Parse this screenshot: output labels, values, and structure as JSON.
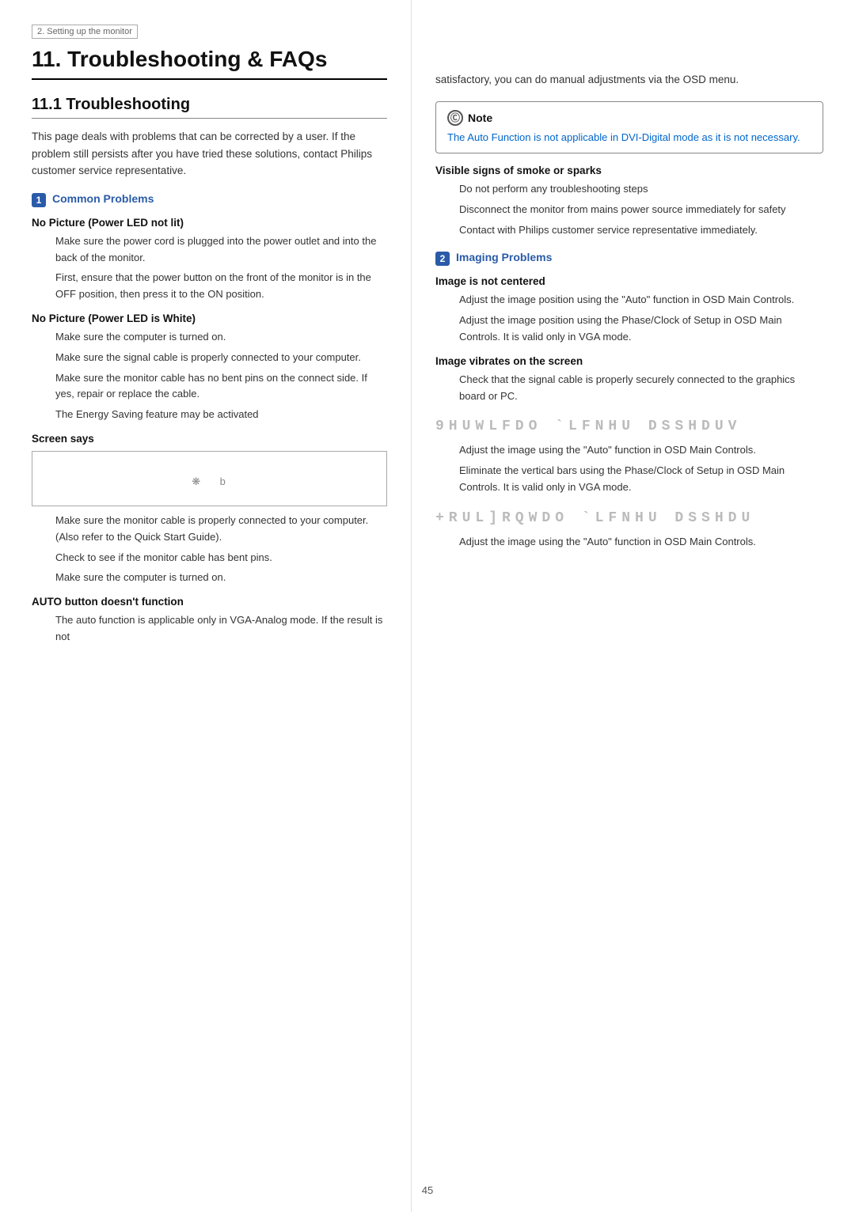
{
  "breadcrumb": "2. Setting up the monitor",
  "chapter": {
    "number": "11.",
    "title": "Troubleshooting & FAQs"
  },
  "section11_1": {
    "title": "11.1 Troubleshooting",
    "intro": "This page deals with problems that can be corrected by a user. If the problem still persists after you have tried these solutions, contact Philips customer service representative."
  },
  "common_problems": {
    "badge": "1",
    "label": "Common Problems",
    "subsections": [
      {
        "title": "No Picture (Power LED not lit)",
        "bullets": [
          "Make sure the power cord is plugged into the power outlet and into the back of the monitor.",
          "First, ensure that the power button on the front of the monitor is in the OFF position, then press it to the ON position."
        ]
      },
      {
        "title": "No Picture (Power LED is White)",
        "bullets": [
          "Make sure the computer is turned on.",
          "Make sure the signal cable is properly connected to your computer.",
          "Make sure the monitor cable has no bent pins on the connect side. If yes, repair or replace the cable.",
          "The Energy Saving feature may be activated"
        ]
      },
      {
        "title": "Screen says",
        "screen_content": "❋    b"
      },
      {
        "after_screen_bullets": [
          "Make sure the monitor cable is properly connected to your computer. (Also refer to the Quick Start Guide).",
          "Check to see if the monitor cable has bent pins.",
          "Make sure the computer is turned on."
        ]
      },
      {
        "title": "AUTO button doesn't function",
        "bullets": [
          "The auto function is applicable only in VGA-Analog mode. If the result is not"
        ]
      }
    ]
  },
  "right_col": {
    "intro_continuation": "satisfactory, you can do manual adjustments via the OSD menu.",
    "note": {
      "header": "Note",
      "text": "The Auto Function is not applicable in DVI-Digital mode as it is not necessary."
    },
    "visible_signs": {
      "title": "Visible signs of smoke or sparks",
      "bullets": [
        "Do not perform any troubleshooting steps",
        "Disconnect the monitor from mains power source immediately for safety",
        "Contact with Philips customer service representative immediately."
      ]
    },
    "imaging_problems": {
      "badge": "2",
      "label": "Imaging Problems",
      "subsections": [
        {
          "title": "Image is not centered",
          "bullets": [
            "Adjust the image position using the \"Auto\" function in OSD Main Controls.",
            "Adjust the image position using the Phase/Clock of Setup in OSD Main Controls. It is valid only in VGA mode."
          ]
        },
        {
          "title": "Image vibrates on the screen",
          "bullets": [
            "Check that the signal cable is properly securely connected to the graphics board or PC."
          ]
        }
      ]
    },
    "vertical_ticker": "9HUWLFDO `LFNHU DSSHDUV",
    "vertical_ticker_bullets": [
      "Adjust the image using the \"Auto\" function in OSD Main Controls.",
      "Eliminate the vertical bars using the Phase/Clock of Setup in OSD Main Controls. It is valid only in VGA mode."
    ],
    "horizontal_ticker": "+RUL]RQWDO `LFNHU DSSHDU",
    "horizontal_ticker_bullets": [
      "Adjust the image using the \"Auto\" function in OSD Main Controls."
    ]
  },
  "page_number": "45"
}
